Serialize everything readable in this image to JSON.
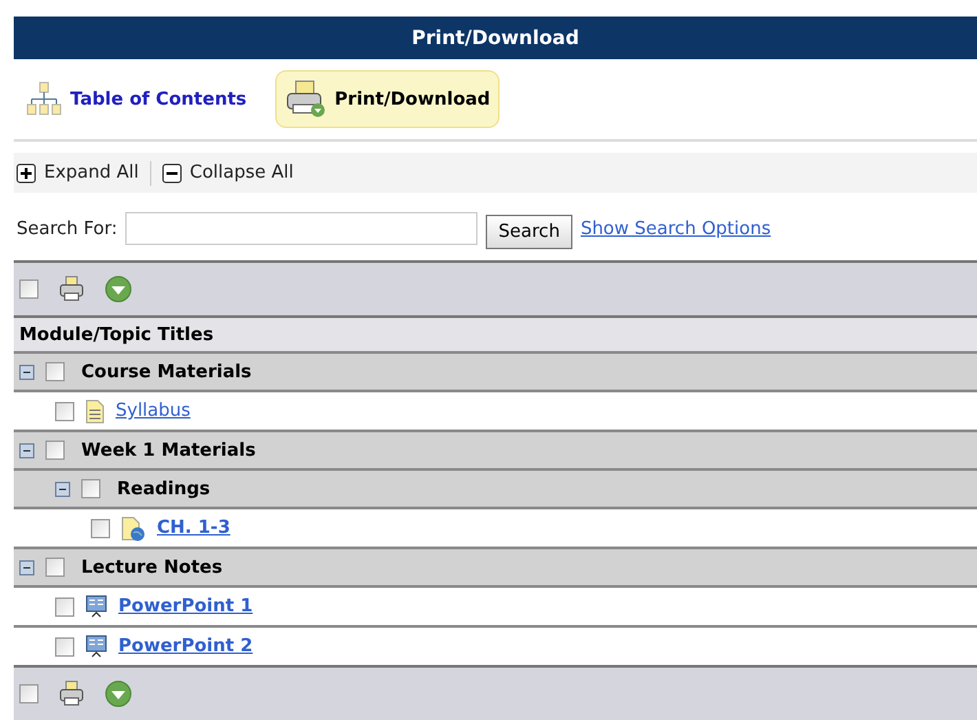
{
  "window": {
    "title": "Print/Download"
  },
  "tabs": [
    {
      "label": "Table of Contents",
      "kind": "toc",
      "selected": false
    },
    {
      "label": "Print/Download",
      "kind": "print",
      "selected": true
    }
  ],
  "actions": [
    {
      "label": "Expand All",
      "kind": "expand"
    },
    {
      "label": "Collapse All",
      "kind": "collapse"
    }
  ],
  "search": {
    "label": "Search For:",
    "button": "Search",
    "options_link": "Show Search Options"
  },
  "top_toolbar": {
    "checked": false
  },
  "table": {
    "heading": "Module/Topic Titles",
    "rows": [
      {
        "kind": "module",
        "title": "Course Materials",
        "expanded": true,
        "checked": false,
        "children": [
          {
            "kind": "document",
            "title": "Syllabus",
            "bold": false,
            "checked": false
          }
        ]
      },
      {
        "kind": "module",
        "title": "Week 1 Materials",
        "expanded": true,
        "checked": false,
        "children": [
          {
            "kind": "module",
            "title": "Readings",
            "expanded": true,
            "checked": false,
            "children": [
              {
                "kind": "web",
                "title": "CH. 1-3",
                "bold": true,
                "checked": false
              }
            ]
          }
        ]
      },
      {
        "kind": "module",
        "title": "Lecture Notes",
        "expanded": true,
        "checked": false,
        "children": [
          {
            "kind": "presentation",
            "title": "PowerPoint 1",
            "bold": true,
            "checked": false
          },
          {
            "kind": "presentation",
            "title": "PowerPoint 2",
            "bold": true,
            "checked": false
          }
        ]
      }
    ]
  },
  "bottom_toolbar": {
    "checked": false
  }
}
